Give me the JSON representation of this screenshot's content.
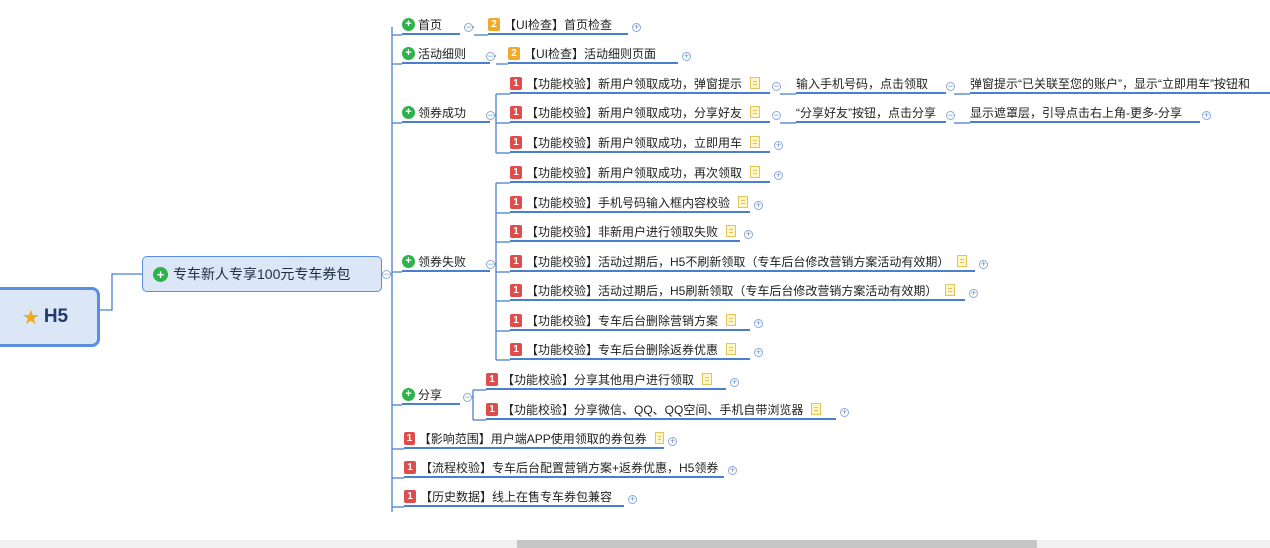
{
  "root": {
    "label": "H5",
    "icon": "star-icon"
  },
  "main": {
    "label": "专车新人专享100元专车券包",
    "icon": "plus-icon"
  },
  "branches": [
    {
      "label": "首页",
      "children": [
        {
          "priority": "2",
          "text": "【UI检查】首页检查"
        }
      ]
    },
    {
      "label": "活动细则",
      "children": [
        {
          "priority": "2",
          "text": "【UI检查】活动细则页面"
        }
      ]
    },
    {
      "label": "领券成功",
      "children": [
        {
          "priority": "1",
          "text": "【功能校验】新用户领取成功，弹窗提示",
          "step": "输入手机号码，点击领取",
          "result": "弹窗提示“已关联至您的账户”，显示“立即用车”按钮和"
        },
        {
          "priority": "1",
          "text": "【功能校验】新用户领取成功，分享好友",
          "step": "“分享好友”按钮，点击分享",
          "result": "显示遮罩层，引导点击右上角-更多-分享"
        },
        {
          "priority": "1",
          "text": "【功能校验】新用户领取成功，立即用车"
        }
      ]
    },
    {
      "label": "领券失败",
      "children": [
        {
          "priority": "1",
          "text": "【功能校验】新用户领取成功，再次领取"
        },
        {
          "priority": "1",
          "text": "【功能校验】手机号码输入框内容校验"
        },
        {
          "priority": "1",
          "text": "【功能校验】非新用户进行领取失败"
        },
        {
          "priority": "1",
          "text": "【功能校验】活动过期后，H5不刷新领取（专车后台修改营销方案活动有效期）"
        },
        {
          "priority": "1",
          "text": "【功能校验】活动过期后，H5刷新领取（专车后台修改营销方案活动有效期）"
        },
        {
          "priority": "1",
          "text": "【功能校验】专车后台删除营销方案"
        },
        {
          "priority": "1",
          "text": "【功能校验】专车后台删除返券优惠"
        }
      ]
    },
    {
      "label": "分享",
      "children": [
        {
          "priority": "1",
          "text": "【功能校验】分享其他用户进行领取"
        },
        {
          "priority": "1",
          "text": "【功能校验】分享微信、QQ、QQ空间、手机自带浏览器"
        }
      ]
    }
  ],
  "leaves": [
    {
      "priority": "1",
      "text": "【影响范围】用户端APP使用领取的券包券"
    },
    {
      "priority": "1",
      "text": "【流程校验】专车后台配置营销方案+返券优惠，H5领券"
    },
    {
      "priority": "1",
      "text": "【历史数据】线上在售专车券包兼容"
    }
  ],
  "colors": {
    "line": "#4a7fd0",
    "p1": "#e04b4b",
    "p2": "#f0a92b",
    "plus": "#2db34a"
  }
}
